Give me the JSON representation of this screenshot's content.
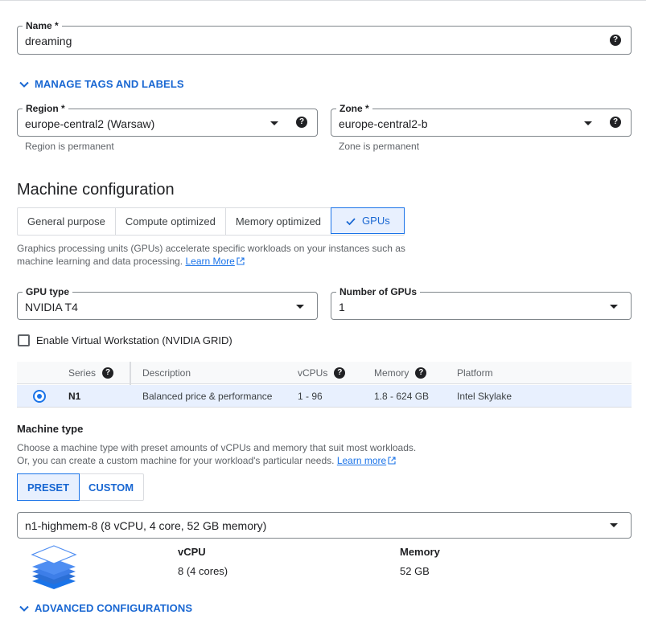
{
  "name_field": {
    "label": "Name *",
    "value": "dreaming"
  },
  "manage_tags": {
    "label": "MANAGE TAGS AND LABELS"
  },
  "region": {
    "label": "Region *",
    "value": "europe-central2 (Warsaw)",
    "hint": "Region is permanent"
  },
  "zone": {
    "label": "Zone *",
    "value": "europe-central2-b",
    "hint": "Zone is permanent"
  },
  "machine_config": {
    "title": "Machine configuration",
    "tabs": [
      {
        "label": "General purpose"
      },
      {
        "label": "Compute optimized"
      },
      {
        "label": "Memory optimized"
      },
      {
        "label": "GPUs",
        "active": true
      }
    ],
    "description_line1": "Graphics processing units (GPUs) accelerate specific workloads on your instances such as",
    "description_line2": "machine learning and data processing.",
    "learn_more": "Learn More"
  },
  "gpu_type": {
    "label": "GPU type",
    "value": "NVIDIA T4"
  },
  "gpu_count": {
    "label": "Number of GPUs",
    "value": "1"
  },
  "virtual_workstation": {
    "label": "Enable Virtual Workstation (NVIDIA GRID)",
    "checked": false
  },
  "series_table": {
    "headers": [
      "Series",
      "Description",
      "vCPUs",
      "Memory",
      "Platform"
    ],
    "rows": [
      {
        "series": "N1",
        "description": "Balanced price & performance",
        "vcpus": "1 - 96",
        "memory": "1.8 - 624 GB",
        "platform": "Intel Skylake",
        "selected": true
      }
    ]
  },
  "machine_type": {
    "title": "Machine type",
    "desc_line1": "Choose a machine type with preset amounts of vCPUs and memory that suit most workloads.",
    "desc_line2": "Or, you can create a custom machine for your workload's particular needs.",
    "learn_more": "Learn more",
    "modes": [
      {
        "label": "PRESET",
        "active": true
      },
      {
        "label": "CUSTOM"
      }
    ],
    "selected": "n1-highmem-8 (8 vCPU, 4 core, 52 GB memory)",
    "vcpu_label": "vCPU",
    "vcpu_value": "8 (4 cores)",
    "memory_label": "Memory",
    "memory_value": "52 GB"
  },
  "advanced": {
    "label": "ADVANCED CONFIGURATIONS"
  },
  "icons": {
    "help": "help-circle-icon",
    "dropdown": "dropdown-arrow-icon",
    "expand": "chevron-down-icon",
    "external": "open-in-new-icon",
    "check": "check-icon",
    "machine": "stacked-layers-icon"
  },
  "colors": {
    "accent": "#1a73e8",
    "accent_bg": "#e8f0fe",
    "text": "#202124",
    "muted": "#5f6368",
    "border": "#dadce0"
  }
}
